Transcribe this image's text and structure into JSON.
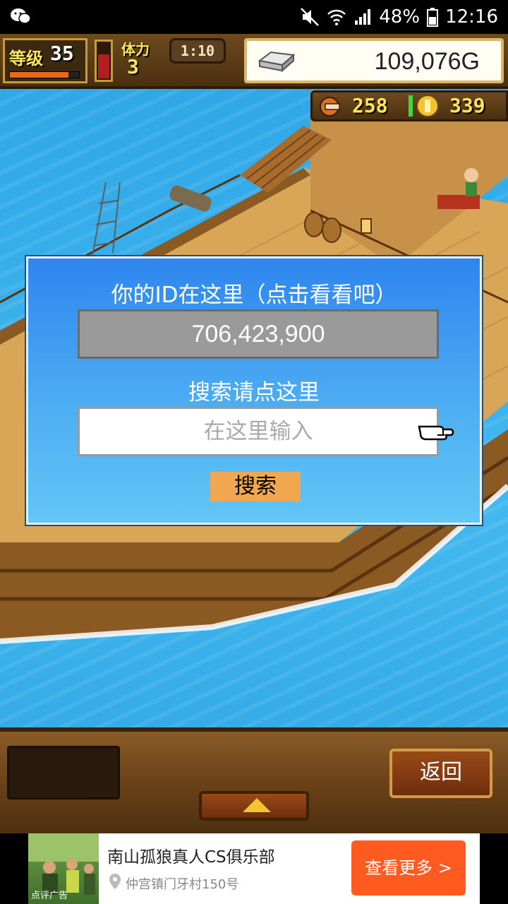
{
  "status_bar": {
    "battery_percent": "48%",
    "time": "12:16",
    "icons": [
      "wechat-icon",
      "mute-icon",
      "wifi-icon",
      "signal-icon",
      "battery-icon"
    ]
  },
  "hud": {
    "level_label": "等级",
    "level_value": "35",
    "level_progress": 0.85,
    "stamina_gauge_level": 0.7,
    "stamina_label": "体力",
    "stamina_value": "3",
    "timer": "1:10",
    "gold": "109,076G",
    "resource_1": "258",
    "resource_2": "339"
  },
  "dialog": {
    "title": "你的ID在这里（点击看看吧）",
    "id_value": "706,423,900",
    "search_label": "搜索请点这里",
    "search_placeholder": "在这里输入",
    "search_button": "搜索"
  },
  "bottom": {
    "back_label": "返回"
  },
  "ad": {
    "title": "南山孤狼真人CS俱乐部",
    "address": "仲宫镇门牙村150号",
    "cta": "查看更多 >",
    "thumb_label": "点评广告"
  },
  "colors": {
    "dialog_top": "#2e86ee",
    "dialog_bottom": "#62c6f6",
    "search_button": "#f0a750",
    "ad_cta": "#ff5a1f"
  }
}
